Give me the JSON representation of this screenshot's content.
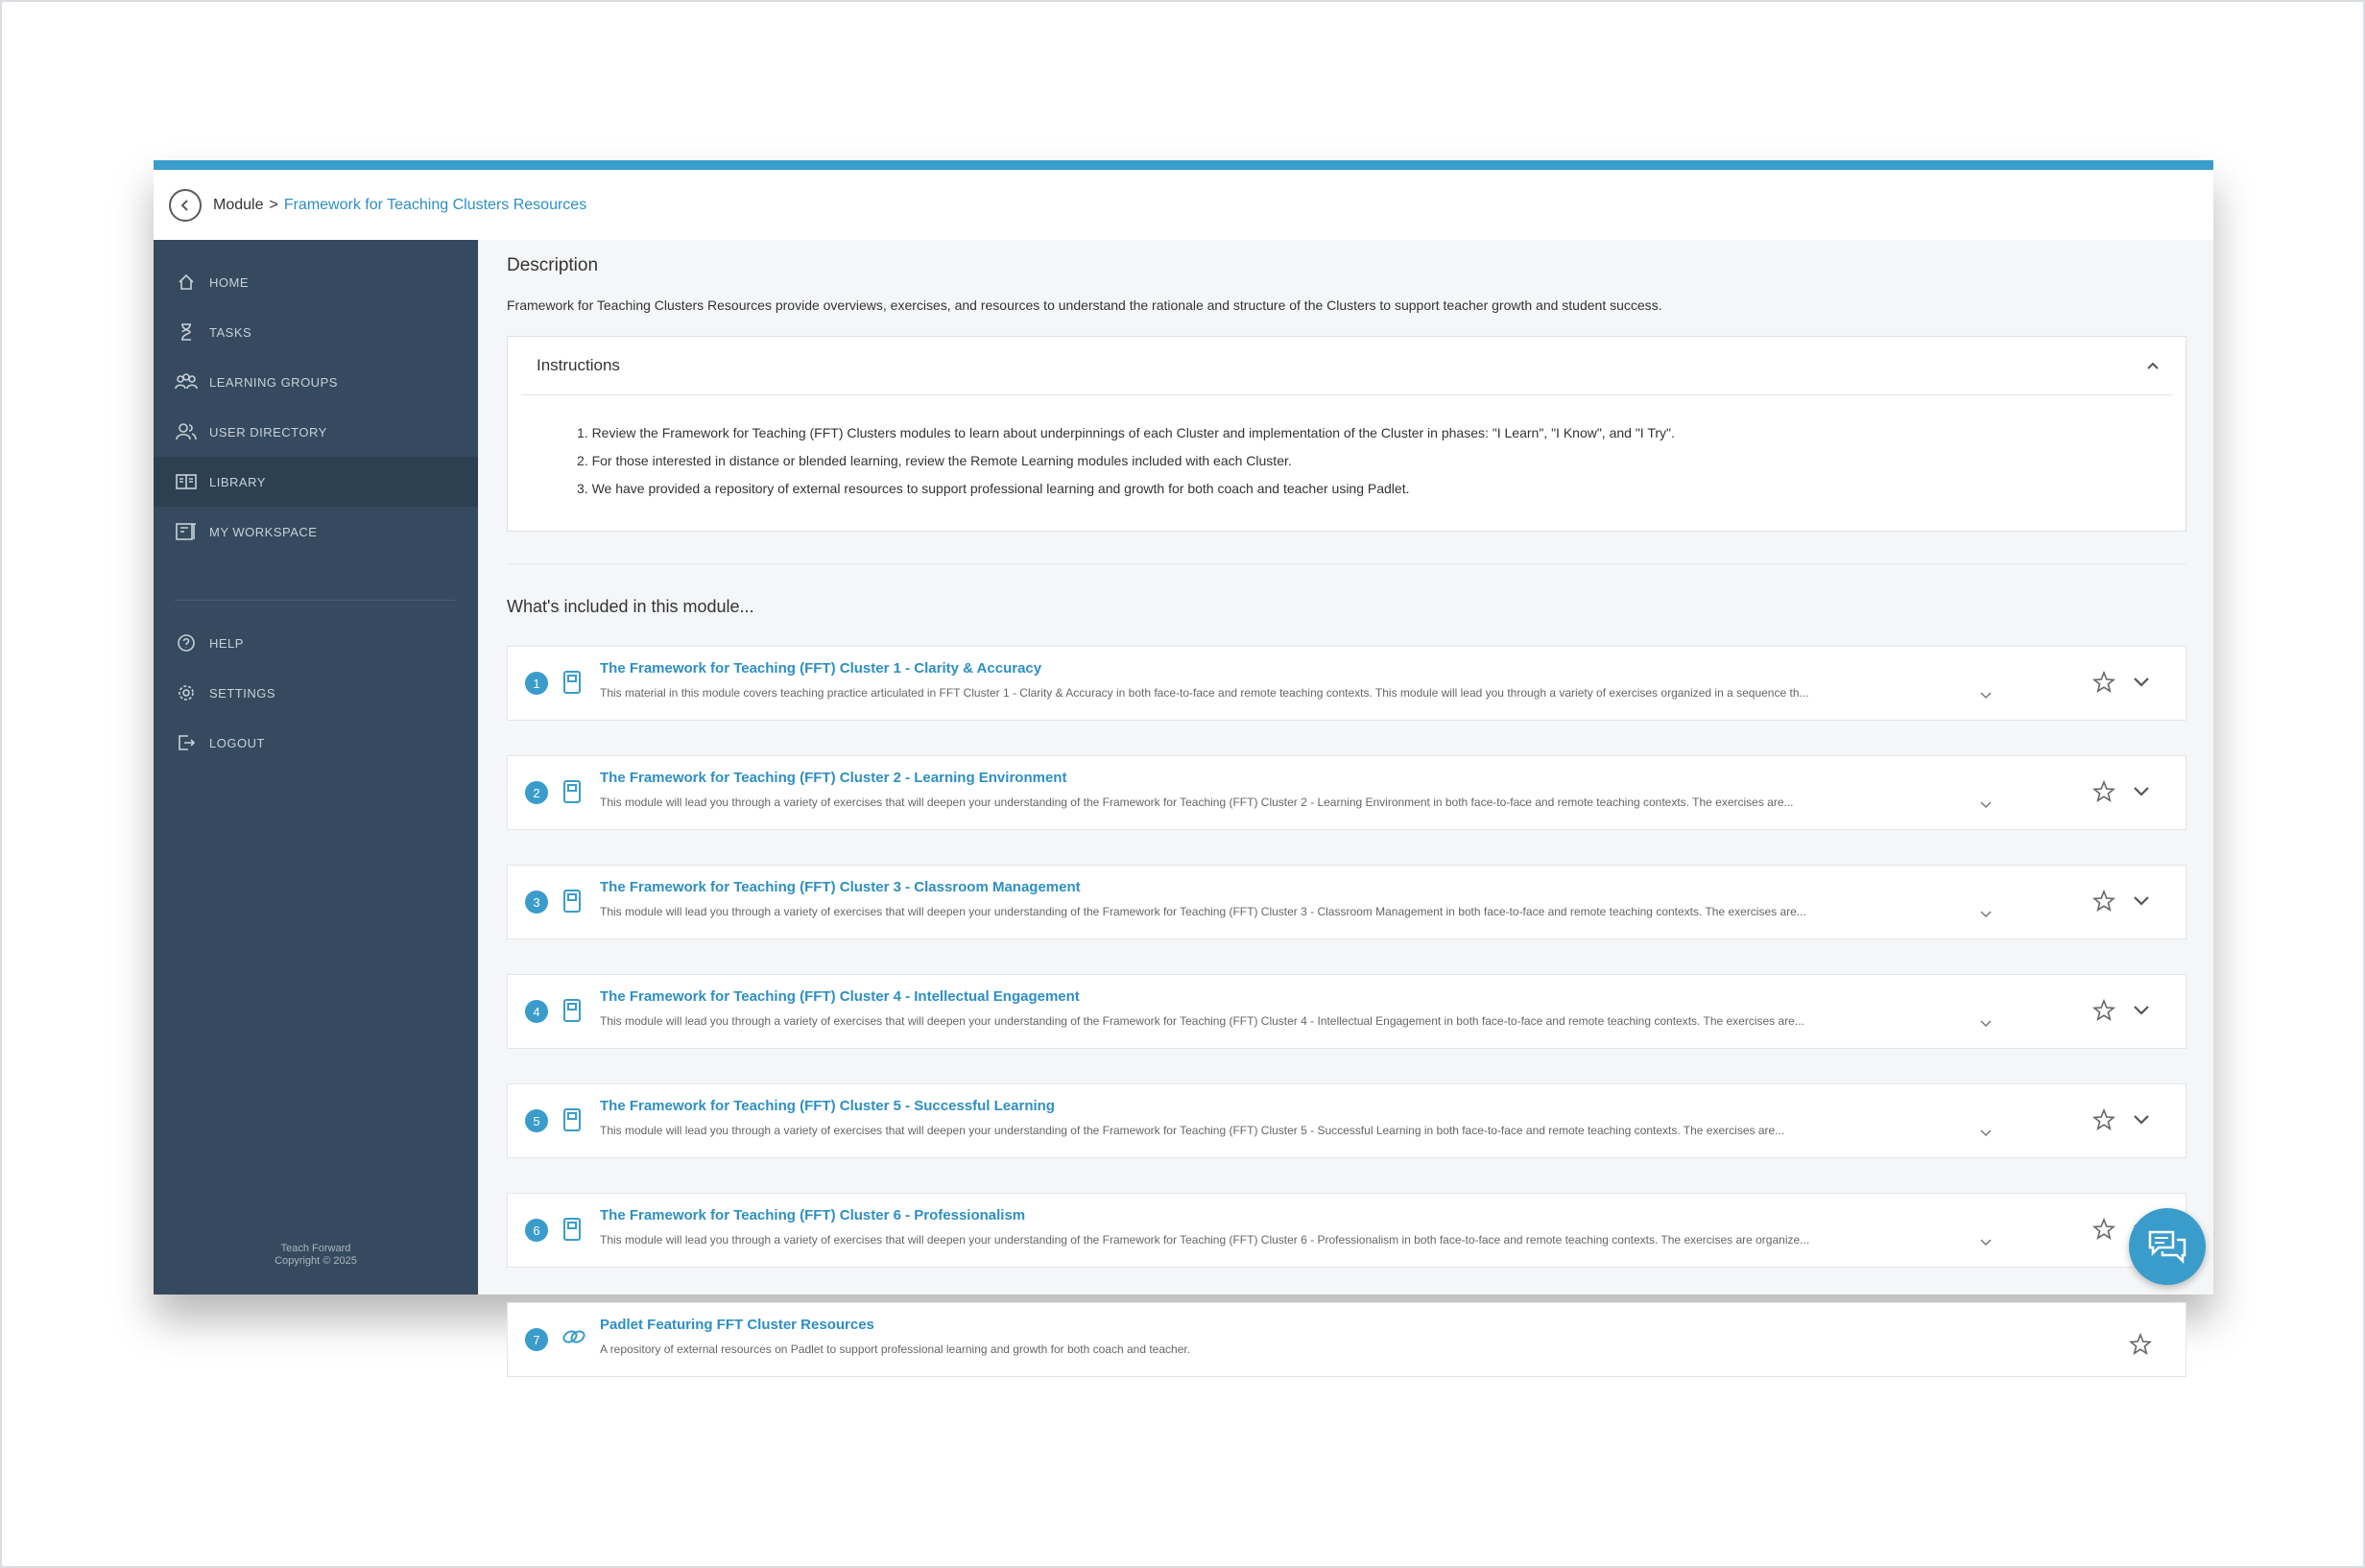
{
  "breadcrumb": {
    "root": "Module",
    "separator": ">",
    "current": "Framework for Teaching Clusters Resources"
  },
  "sidebar": {
    "items": [
      {
        "label": "HOME",
        "icon": "home-icon"
      },
      {
        "label": "TASKS",
        "icon": "hourglass-icon"
      },
      {
        "label": "LEARNING GROUPS",
        "icon": "group-icon"
      },
      {
        "label": "USER DIRECTORY",
        "icon": "users-icon"
      },
      {
        "label": "LIBRARY",
        "icon": "book-open-icon",
        "active": true
      },
      {
        "label": "MY WORKSPACE",
        "icon": "workspace-icon"
      },
      {
        "label": "HELP",
        "icon": "help-icon"
      },
      {
        "label": "SETTINGS",
        "icon": "gear-icon"
      },
      {
        "label": "LOGOUT",
        "icon": "logout-icon"
      }
    ],
    "footer_line1": "Teach Forward",
    "footer_line2": "Copyright © 2025"
  },
  "main": {
    "description_title": "Description",
    "description_text": "Framework for Teaching Clusters Resources provide overviews, exercises, and resources to understand the rationale and structure of the Clusters to support teacher growth and student success.",
    "instructions": {
      "title": "Instructions",
      "items": [
        "1. Review the Framework for Teaching (FFT) Clusters modules to learn about underpinnings of each Cluster and implementation of the Cluster in phases: \"I Learn\", \"I Know\", and \"I Try\".",
        "2. For those interested in distance or blended learning, review the Remote Learning modules included with each Cluster.",
        "3. We have provided a repository of external resources to support professional learning and growth for both coach and teacher using Padlet."
      ]
    },
    "included_title": "What's included in this module...",
    "modules": [
      {
        "num": "1",
        "title": "The Framework for Teaching (FFT) Cluster 1 - Clarity & Accuracy",
        "desc": "This material in this module covers teaching practice articulated in FFT Cluster 1 - Clarity & Accuracy in both face-to-face and remote teaching contexts. This module will lead you through a variety of exercises organized in a sequence th...",
        "kind": "book-icon"
      },
      {
        "num": "2",
        "title": "The Framework for Teaching (FFT) Cluster 2 - Learning Environment",
        "desc": "This module will lead you through a variety of exercises that will deepen your understanding of the Framework for Teaching (FFT) Cluster 2 - Learning Environment in both face-to-face and remote teaching contexts. The exercises are...",
        "kind": "book-icon"
      },
      {
        "num": "3",
        "title": "The Framework for Teaching (FFT) Cluster 3 - Classroom Management",
        "desc": "This module will lead you through a variety of exercises that will deepen your understanding of the Framework for Teaching (FFT) Cluster 3 - Classroom Management in both face-to-face and remote teaching contexts. The exercises are...",
        "kind": "book-icon"
      },
      {
        "num": "4",
        "title": "The Framework for Teaching (FFT) Cluster 4 - Intellectual Engagement",
        "desc": "This module will lead you through a variety of exercises that will deepen your understanding of the Framework for Teaching (FFT) Cluster 4 - Intellectual Engagement in both face-to-face and remote teaching contexts. The exercises are...",
        "kind": "book-icon"
      },
      {
        "num": "5",
        "title": "The Framework for Teaching (FFT) Cluster 5 - Successful Learning",
        "desc": "This module will lead you through a variety of exercises that will deepen your understanding of the Framework for Teaching (FFT) Cluster 5 - Successful Learning in both face-to-face and remote teaching contexts. The exercises are...",
        "kind": "book-icon"
      },
      {
        "num": "6",
        "title": "The Framework for Teaching (FFT) Cluster 6 - Professionalism",
        "desc": "This module will lead you through a variety of exercises that will deepen your understanding of the Framework for Teaching (FFT) Cluster 6 - Professionalism in both face-to-face and remote teaching contexts. The exercises are organize...",
        "kind": "book-icon"
      },
      {
        "num": "7",
        "title": "Padlet Featuring FFT Cluster Resources",
        "desc": "A repository of external resources on Padlet to support professional learning and growth for both coach and teacher.",
        "kind": "link-icon"
      }
    ]
  },
  "colors": {
    "accent": "#3a9ccb",
    "sidebar_bg": "#354a5e",
    "sidebar_active": "#2d4052",
    "link": "#2d8fc3"
  },
  "chat_button": {
    "icon": "chat-icon"
  }
}
